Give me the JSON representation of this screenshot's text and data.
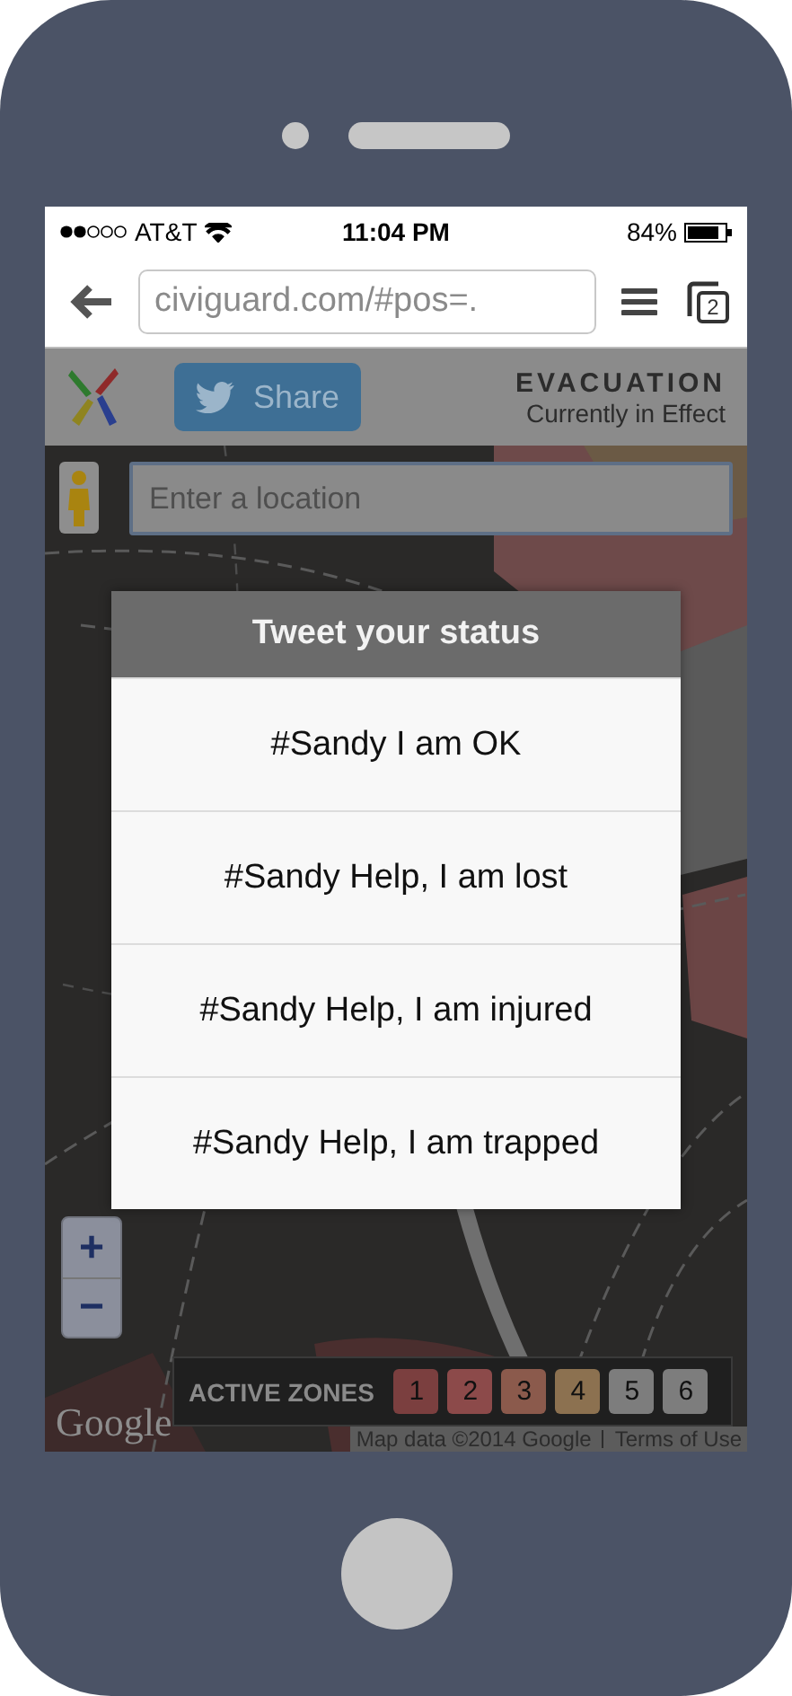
{
  "status_bar": {
    "carrier": "AT&T",
    "time": "11:04 PM",
    "battery": "84%"
  },
  "browser": {
    "url": "civiguard.com/#pos=.",
    "tab_count": "2"
  },
  "header": {
    "share": "Share",
    "title": "EVACUATION",
    "subtitle": "Currently in Effect"
  },
  "map": {
    "search": {
      "placeholder": "Enter a location"
    },
    "zoom_in": "+",
    "zoom_out": "−",
    "zones_label": "ACTIVE ZONES",
    "zones": [
      {
        "label": "1",
        "color": "#7b3f3f"
      },
      {
        "label": "2",
        "color": "#8c4a4a"
      },
      {
        "label": "3",
        "color": "#8b5a4c"
      },
      {
        "label": "4",
        "color": "#8c7150"
      },
      {
        "label": "5",
        "color": "#7d7d7d"
      },
      {
        "label": "6",
        "color": "#7d7d7d"
      }
    ],
    "logo": "Google",
    "attribution": "Map data ©2014 Google",
    "terms": "Terms of Use"
  },
  "dialog": {
    "title": "Tweet your status",
    "options": [
      "#Sandy I am OK",
      "#Sandy Help, I am lost",
      "#Sandy Help, I am injured",
      "#Sandy Help, I am trapped"
    ]
  }
}
